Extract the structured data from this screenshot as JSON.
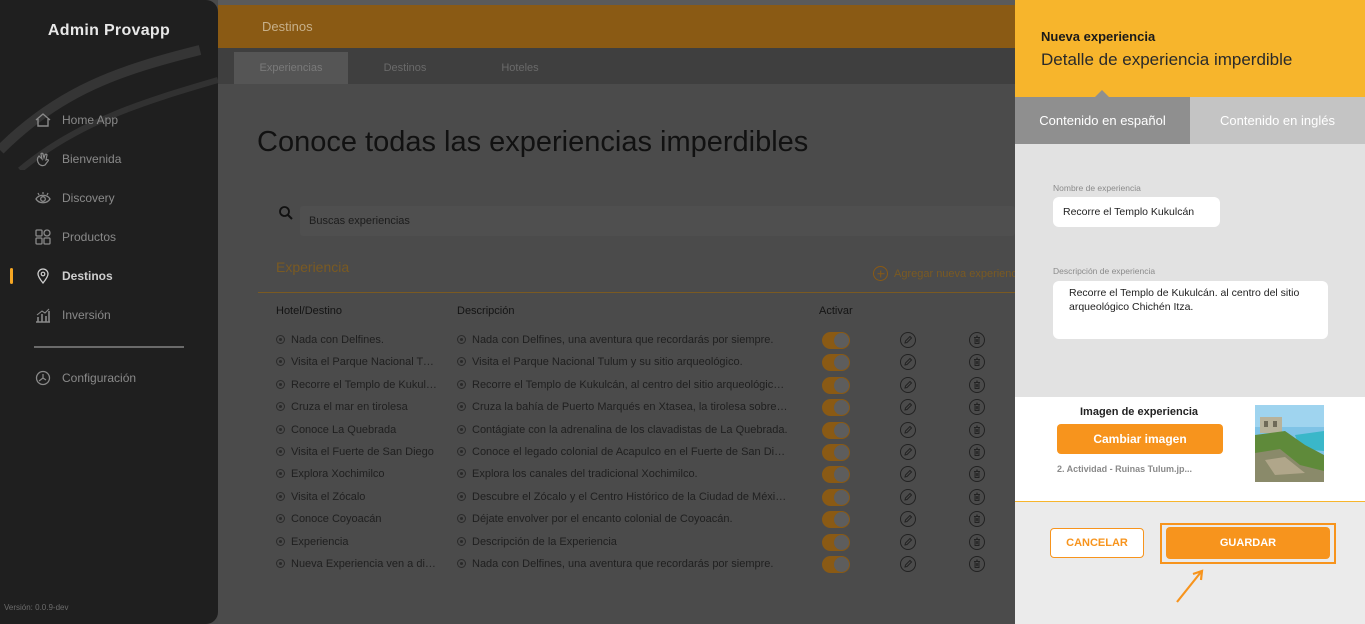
{
  "sidebar": {
    "app_name": "Admin Provapp",
    "items": [
      {
        "label": "Home App",
        "icon": "home-icon"
      },
      {
        "label": "Bienvenida",
        "icon": "wave-hand-icon"
      },
      {
        "label": "Discovery",
        "icon": "eye-icon"
      },
      {
        "label": "Productos",
        "icon": "grid-icon"
      },
      {
        "label": "Destinos",
        "icon": "map-pin-icon",
        "active": true
      },
      {
        "label": "Inversión",
        "icon": "bar-chart-icon"
      }
    ],
    "settings_label": "Configuración",
    "version": "Versión: 0.0.9-dev"
  },
  "header": {
    "title": "Destinos"
  },
  "tabs": [
    "Experiencias",
    "Destinos",
    "Hoteles"
  ],
  "main": {
    "page_title": "Conoce todas las experiencias imperdibles",
    "search_placeholder": "Buscas experiencias",
    "section_title": "Experiencia",
    "add_link": "Agregar nueva experiencia",
    "columns": {
      "hotel": "Hotel/Destino",
      "desc": "Descripción",
      "active": "Activar"
    },
    "rows": [
      {
        "hotel": "Nada con Delfines.",
        "desc": "Nada con Delfines, una aventura que recordarás por siempre."
      },
      {
        "hotel": "Visita el Parque Nacional Tulum",
        "desc": "Visita el Parque Nacional Tulum y su sitio arqueológico."
      },
      {
        "hotel": "Recorre el Templo de Kukulcán",
        "desc": "Recorre el Templo de Kukulcán, al centro del sitio arqueológico Chichén Itza."
      },
      {
        "hotel": "Cruza el mar en tirolesa",
        "desc": "Cruza la bahía de Puerto Marqués en Xtasea, la tirolesa sobre el mar."
      },
      {
        "hotel": "Conoce La Quebrada",
        "desc": "Contágiate con la adrenalina de los clavadistas de La Quebrada."
      },
      {
        "hotel": "Visita el Fuerte de San Diego",
        "desc": "Conoce el legado colonial de Acapulco en el Fuerte de San Diego."
      },
      {
        "hotel": "Explora Xochimilco",
        "desc": "Explora los canales del tradicional Xochimilco."
      },
      {
        "hotel": "Visita el Zócalo",
        "desc": "Descubre el Zócalo y el Centro Histórico de la Ciudad de México."
      },
      {
        "hotel": "Conoce Coyoacán",
        "desc": "Déjate envolver por el encanto colonial de Coyoacán."
      },
      {
        "hotel": "Experiencia",
        "desc": "Descripción de la Experiencia"
      },
      {
        "hotel": "Nueva Experiencia ven a disfrutar",
        "desc": "Nada con Delfines, una aventura que recordarás por siempre."
      }
    ]
  },
  "panel": {
    "title": "Nueva experiencia",
    "subtitle": "Detalle de experiencia imperdible",
    "tab_es": "Contenido en español",
    "tab_en": "Contenido en inglés",
    "name_label": "Nombre de experiencia",
    "name_value": "Recorre el Templo Kukulcán",
    "desc_label": "Descripción de experiencia",
    "desc_value": "Recorre el Templo de Kukulcán. al centro del sitio arqueológico Chichén Itza.",
    "image_label": "Imagen de experiencia",
    "change_image": "Cambiar imagen",
    "file_name": "2. Actividad - Ruinas Tulum.jp...",
    "cancel": "CANCELAR",
    "save": "GUARDAR"
  },
  "colors": {
    "accent": "#f7941d",
    "header_yellow": "#f7b52c",
    "sidebar": "#1f1f1f"
  }
}
